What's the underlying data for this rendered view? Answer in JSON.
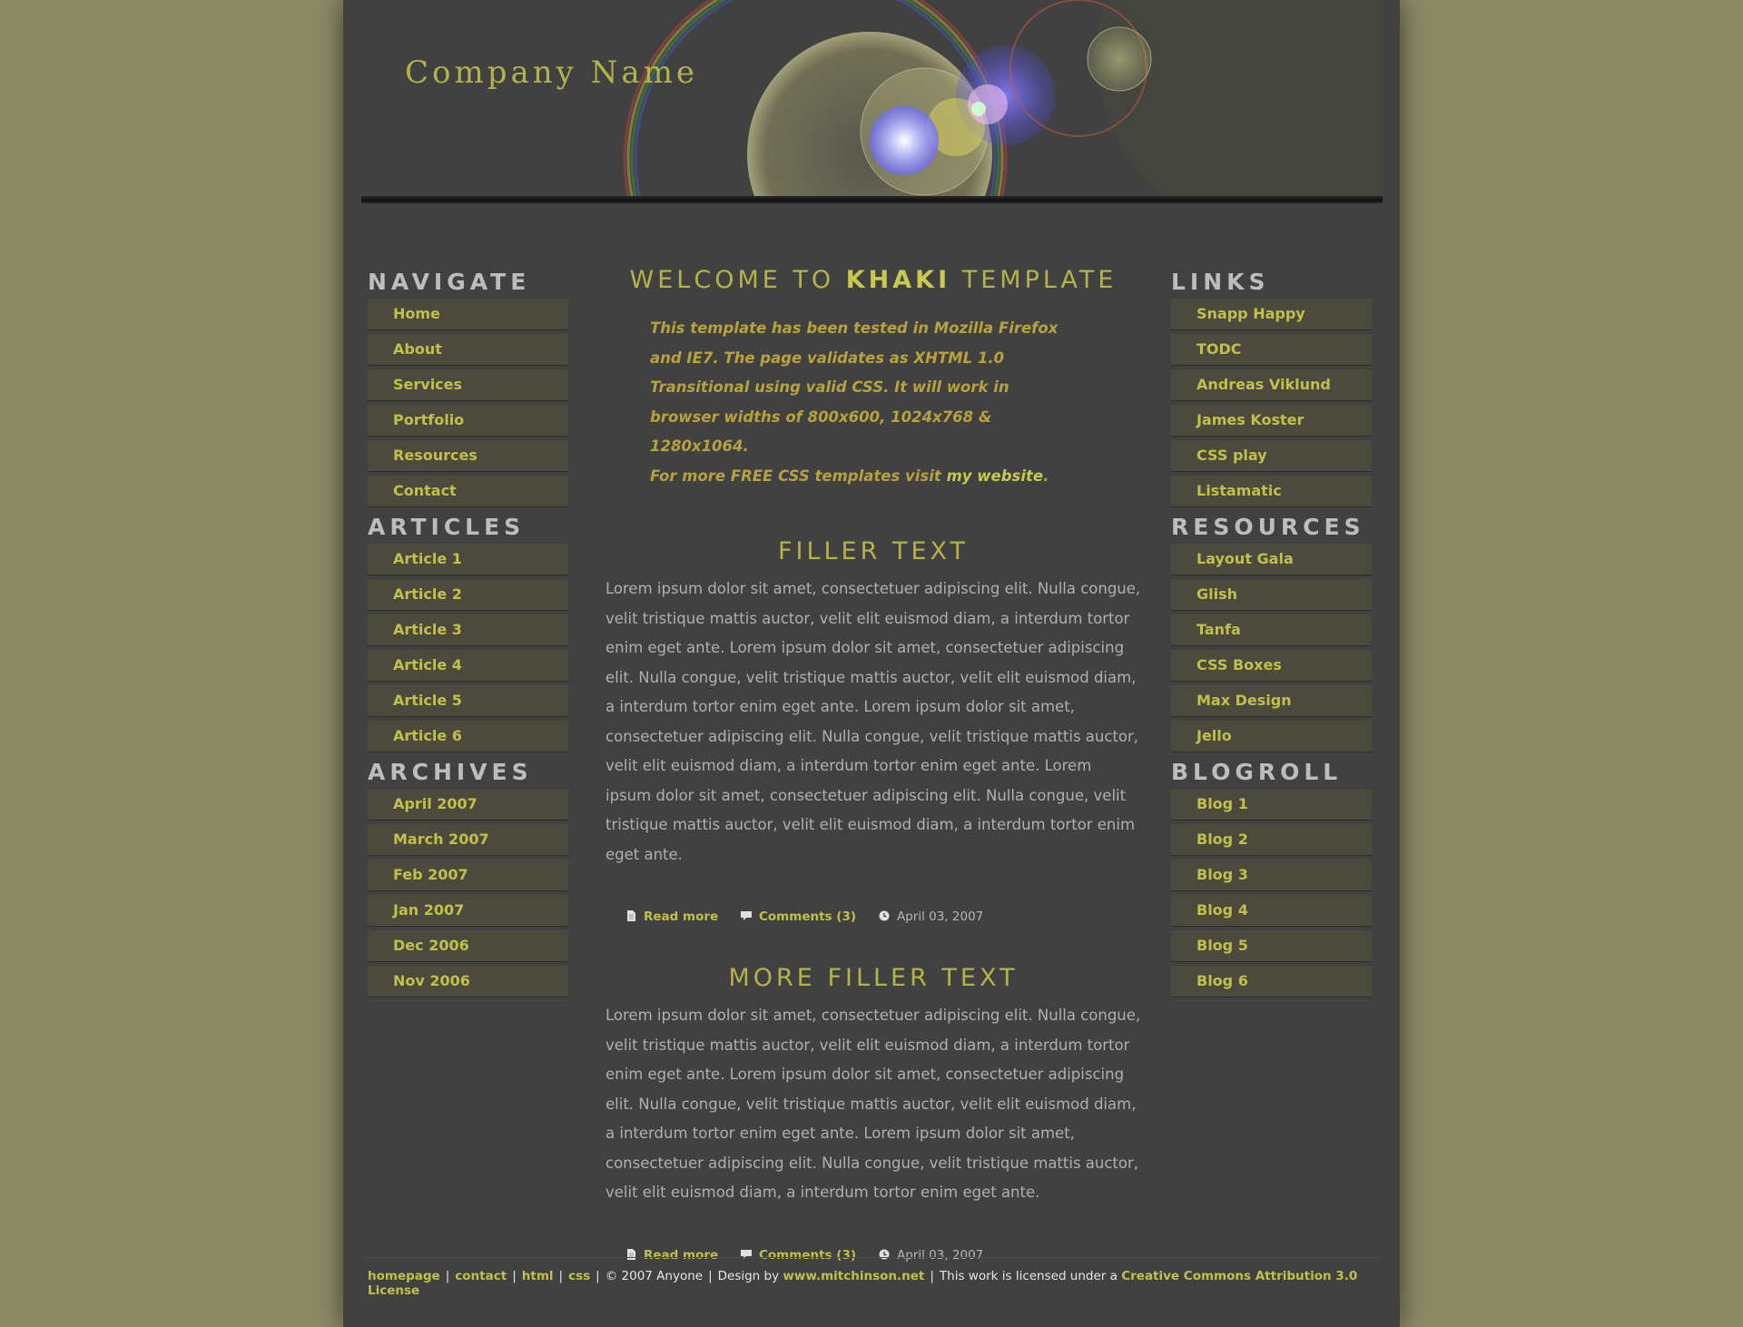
{
  "header": {
    "company_name": "Company Name"
  },
  "left_sidebar": [
    {
      "heading": "NAVIGATE",
      "items": [
        "Home",
        "About",
        "Services",
        "Portfolio",
        "Resources",
        "Contact"
      ]
    },
    {
      "heading": "ARTICLES",
      "items": [
        "Article 1",
        "Article 2",
        "Article 3",
        "Article 4",
        "Article 5",
        "Article 6"
      ]
    },
    {
      "heading": "ARCHIVES",
      "items": [
        "April 2007",
        "March 2007",
        "Feb 2007",
        "Jan 2007",
        "Dec 2006",
        "Nov 2006"
      ]
    }
  ],
  "right_sidebar": [
    {
      "heading": "LINKS",
      "items": [
        "Snapp Happy",
        "TODC",
        "Andreas Viklund",
        "James Koster",
        "CSS play",
        "Listamatic"
      ]
    },
    {
      "heading": "RESOURCES",
      "items": [
        "Layout Gala",
        "Glish",
        "Tanfa",
        "CSS Boxes",
        "Max Design",
        "Jello"
      ]
    },
    {
      "heading": "BLOGROLL",
      "items": [
        "Blog 1",
        "Blog 2",
        "Blog 3",
        "Blog 4",
        "Blog 5",
        "Blog 6"
      ]
    }
  ],
  "main": {
    "welcome_prefix": "WELCOME TO",
    "welcome_brand": "KHAKI",
    "welcome_suffix": "TEMPLATE",
    "intro_text": "This template has been tested in Mozilla Firefox and IE7. The page validates as XHTML 1.0 Transitional using valid CSS. It will work in browser widths of 800x600, 1024x768 & 1280x1064.",
    "intro_more": "For more FREE CSS templates visit",
    "intro_link": "my website",
    "intro_end": ".",
    "posts": [
      {
        "title": "FILLER TEXT",
        "body": "Lorem ipsum dolor sit amet, consectetuer adipiscing elit. Nulla congue, velit tristique mattis auctor, velit elit euismod diam, a interdum tortor enim eget ante. Lorem ipsum dolor sit amet, consectetuer adipiscing elit. Nulla congue, velit tristique mattis auctor, velit elit euismod diam, a interdum tortor enim eget ante. Lorem ipsum dolor sit amet, consectetuer adipiscing elit. Nulla congue, velit tristique mattis auctor, velit elit euismod diam, a interdum tortor enim eget ante. Lorem ipsum dolor sit amet, consectetuer adipiscing elit. Nulla congue, velit tristique mattis auctor, velit elit euismod diam, a interdum tortor enim eget ante.",
        "read_more": "Read more",
        "comments": "Comments (3)",
        "date": "April 03, 2007"
      },
      {
        "title": "MORE FILLER TEXT",
        "body": "Lorem ipsum dolor sit amet, consectetuer adipiscing elit. Nulla congue, velit tristique mattis auctor, velit elit euismod diam, a interdum tortor enim eget ante. Lorem ipsum dolor sit amet, consectetuer adipiscing elit. Nulla congue, velit tristique mattis auctor, velit elit euismod diam, a interdum tortor enim eget ante. Lorem ipsum dolor sit amet, consectetuer adipiscing elit. Nulla congue, velit tristique mattis auctor, velit elit euismod diam, a interdum tortor enim eget ante.",
        "read_more": "Read more",
        "comments": "Comments (3)",
        "date": "April 03, 2007"
      }
    ]
  },
  "footer": {
    "links": [
      "homepage",
      "contact",
      "html",
      "css"
    ],
    "copyright": "© 2007 Anyone",
    "design_by": "Design by",
    "designer_link": "www.mitchinson.net",
    "license_text": "This work is licensed under a",
    "license_link": "Creative Commons Attribution 3.0 License"
  },
  "colors": {
    "page_bg": "#8a8a66",
    "panel_bg": "#414141",
    "accent": "#c0c04a",
    "menu_item_bg": "#4b4a3c"
  },
  "icons": {
    "read_more": "page-icon",
    "comments": "speech-bubble-icon",
    "date": "clock-icon"
  }
}
